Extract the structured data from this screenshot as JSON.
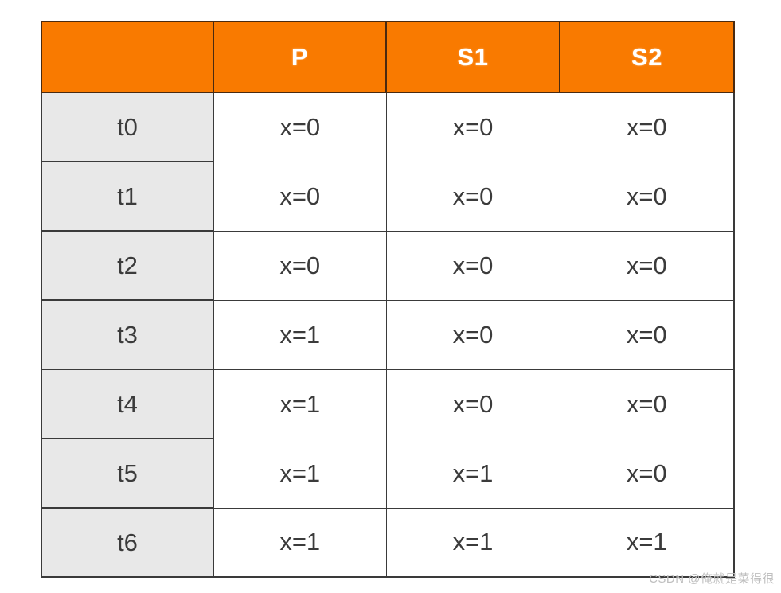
{
  "table": {
    "headers": [
      "",
      "P",
      "S1",
      "S2"
    ],
    "row_label_header": "",
    "rows": [
      {
        "label": "t0",
        "cells": [
          "x=0",
          "x=0",
          "x=0"
        ]
      },
      {
        "label": "t1",
        "cells": [
          "x=0",
          "x=0",
          "x=0"
        ]
      },
      {
        "label": "t2",
        "cells": [
          "x=0",
          "x=0",
          "x=0"
        ]
      },
      {
        "label": "t3",
        "cells": [
          "x=1",
          "x=0",
          "x=0"
        ]
      },
      {
        "label": "t4",
        "cells": [
          "x=1",
          "x=0",
          "x=0"
        ]
      },
      {
        "label": "t5",
        "cells": [
          "x=1",
          "x=1",
          "x=0"
        ]
      },
      {
        "label": "t6",
        "cells": [
          "x=1",
          "x=1",
          "x=1"
        ]
      }
    ]
  },
  "watermark": {
    "text": "CSDN @俺就是菜得很"
  },
  "colors": {
    "header_background": "#f97a00",
    "header_text": "#ffffff",
    "row_label_background": "#e8e8e8",
    "cell_text": "#3b3b3b",
    "border": "#3a3a3a",
    "watermark_text": "#bfbfbf"
  }
}
